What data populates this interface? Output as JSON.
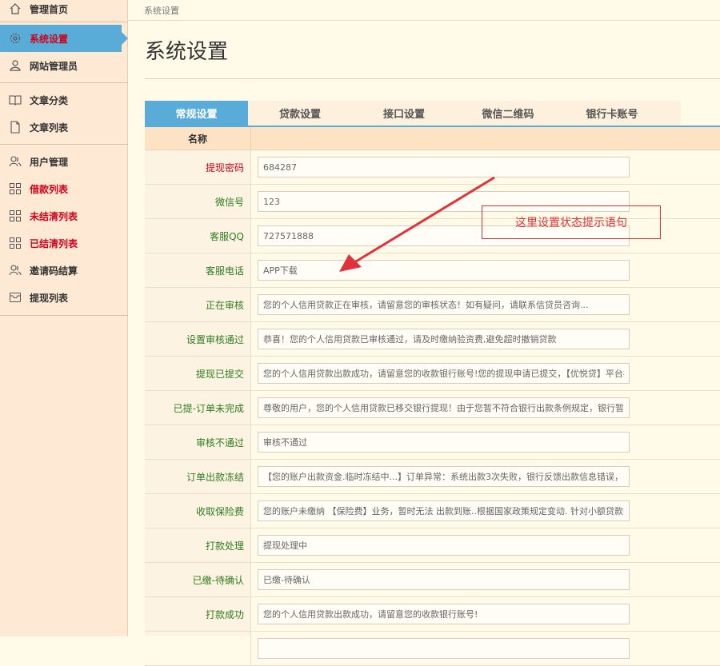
{
  "sidebar": {
    "items": [
      {
        "label": "管理首页",
        "icon": "home-icon"
      },
      {
        "label": "系统设置",
        "icon": "gear-icon"
      },
      {
        "label": "网站管理员",
        "icon": "user-icon"
      },
      {
        "label": "文章分类",
        "icon": "book-icon"
      },
      {
        "label": "文章列表",
        "icon": "document-icon"
      },
      {
        "label": "用户管理",
        "icon": "users-icon"
      },
      {
        "label": "借款列表",
        "icon": "grid-icon"
      },
      {
        "label": "未结清列表",
        "icon": "grid-icon"
      },
      {
        "label": "已结清列表",
        "icon": "grid-icon"
      },
      {
        "label": "邀请码结算",
        "icon": "users-icon"
      },
      {
        "label": "提现列表",
        "icon": "inbox-icon"
      }
    ]
  },
  "breadcrumb": "系统设置",
  "page_title": "系统设置",
  "tabs": [
    "常规设置",
    "贷款设置",
    "接口设置",
    "微信二维码",
    "银行卡账号"
  ],
  "table": {
    "header": "名称",
    "rows": [
      {
        "label": "提现密码",
        "value": "684287"
      },
      {
        "label": "微信号",
        "value": "123"
      },
      {
        "label": "客服QQ",
        "value": "727571888"
      },
      {
        "label": "客服电话",
        "value": "APP下载"
      },
      {
        "label": "正在审核",
        "value": "您的个人信用贷款正在审核，请留意您的审核状态！如有疑问，请联系信贷员咨询..."
      },
      {
        "label": "设置审核通过",
        "value": "恭喜！您的个人信用贷款已审核通过，请及时缴纳验资费,避免超时撤销贷款"
      },
      {
        "label": "提现已提交",
        "value": "您的个人信用贷款出款成功，请留意您的收款银行账号!您的提现申请已提交，【优悦贷】平台拨"
      },
      {
        "label": "已提-订单未完成",
        "value": "尊敬的用户，您的个人信用贷款已移交银行提现！由于您暂不符合银行出款条例规定，银行暂时无"
      },
      {
        "label": "审核不通过",
        "value": "审核不通过"
      },
      {
        "label": "订单出款冻结",
        "value": "【您的账户出款资金.临时冻结中...】订单异常：系统出款3次失败，银行反馈出款信息错误，导致"
      },
      {
        "label": "收取保险费",
        "value": "您的账户未缴纳 【保险费】业务，暂时无法 出款到账..根据国家政策规定变动. 针对小额贷款平台"
      },
      {
        "label": "打款处理",
        "value": "提现处理中"
      },
      {
        "label": "已缴-待确认",
        "value": "已缴-待确认"
      },
      {
        "label": "打款成功",
        "value": "您的个人信用贷款出款成功，请留意您的收款银行账号!"
      },
      {
        "label": "",
        "value": ""
      }
    ]
  },
  "annotation": "这里设置状态提示语句",
  "colors": {
    "accent": "#5aacd8",
    "red": "#d0021b",
    "green": "#2e7d1e",
    "annotation": "#e0323a"
  }
}
